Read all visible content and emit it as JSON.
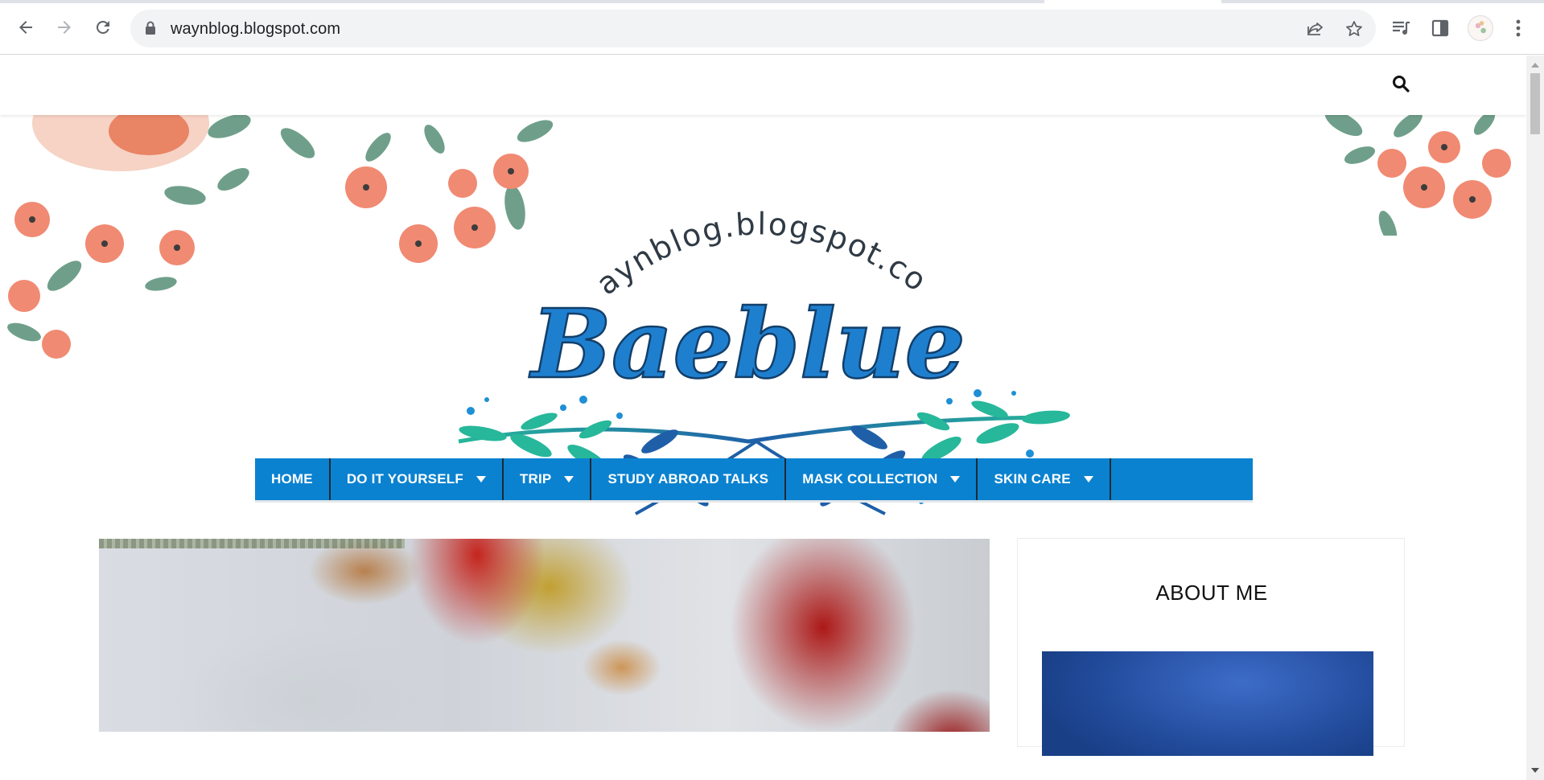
{
  "browser": {
    "url": "waynblog.blogspot.com",
    "icons": [
      "back-arrow-icon",
      "forward-arrow-icon",
      "reload-icon",
      "lock-icon",
      "share-icon",
      "bookmark-star-icon",
      "media-control-icon",
      "side-panel-icon",
      "profile-avatar",
      "more-menu-icon"
    ]
  },
  "header": {
    "search_icon": "search-icon",
    "logo_arc_text": "waynblog.blogspot.com",
    "logo_brand": "Baeblue"
  },
  "nav": {
    "items": [
      {
        "label": "HOME",
        "has_dropdown": false
      },
      {
        "label": "DO IT YOURSELF",
        "has_dropdown": true
      },
      {
        "label": "TRIP",
        "has_dropdown": true
      },
      {
        "label": "STUDY ABROAD TALKS",
        "has_dropdown": false
      },
      {
        "label": "MASK COLLECTION",
        "has_dropdown": true
      },
      {
        "label": "SKIN CARE",
        "has_dropdown": true
      }
    ]
  },
  "sidebar": {
    "title": "ABOUT ME"
  },
  "colors": {
    "nav_bg": "#0a82d0",
    "brand_blue": "#1f7fcf",
    "flower": "#f08a72",
    "leaf": "#6f9f8a"
  }
}
